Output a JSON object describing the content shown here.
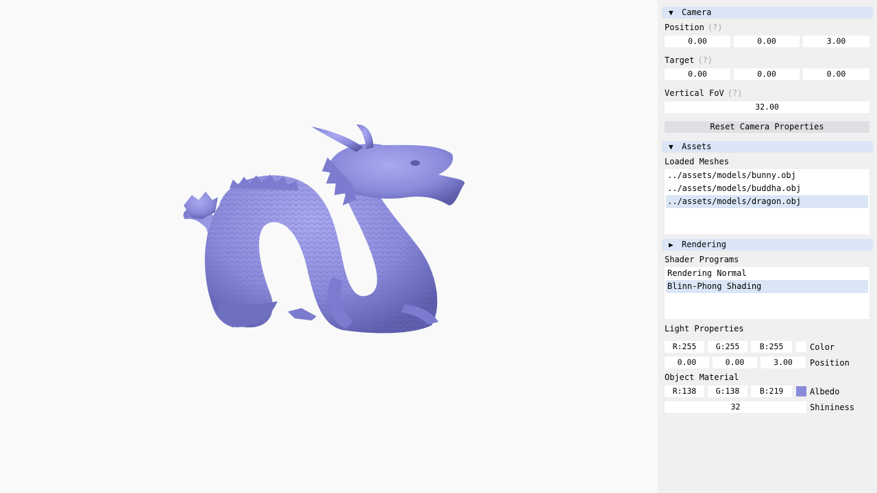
{
  "camera": {
    "header": "Camera",
    "arrow": "▼",
    "position_label": "Position",
    "position": [
      "0.00",
      "0.00",
      "3.00"
    ],
    "target_label": "Target",
    "target": [
      "0.00",
      "0.00",
      "0.00"
    ],
    "fov_label": "Vertical FoV",
    "fov": "32.00",
    "help": "(?)",
    "reset_label": "Reset Camera Properties"
  },
  "assets": {
    "header": "Assets",
    "arrow": "▼",
    "meshes_label": "Loaded Meshes",
    "meshes": [
      "../assets/models/bunny.obj",
      "../assets/models/buddha.obj",
      "../assets/models/dragon.obj"
    ],
    "selected_mesh": "../assets/models/dragon.obj"
  },
  "rendering": {
    "header": "Rendering",
    "arrow": "▶",
    "shaders_label": "Shader Programs",
    "shaders": [
      "Rendering Normal",
      "Blinn-Phong Shading"
    ],
    "selected_shader": "Blinn-Phong Shading",
    "light_label": "Light Properties",
    "light_color": [
      "R:255",
      "G:255",
      "B:255"
    ],
    "light_color_label": "Color",
    "light_color_hex": "#ffffff",
    "light_position": [
      "0.00",
      "0.00",
      "3.00"
    ],
    "light_position_label": "Position",
    "material_label": "Object Material",
    "albedo": [
      "R:138",
      "G:138",
      "B:219"
    ],
    "albedo_label": "Albedo",
    "albedo_hex": "#8a8adb",
    "shininess": "32",
    "shininess_label": "Shininess"
  },
  "viewport": {
    "background": "#f9f9f9",
    "model_color": "#8a8adb"
  }
}
